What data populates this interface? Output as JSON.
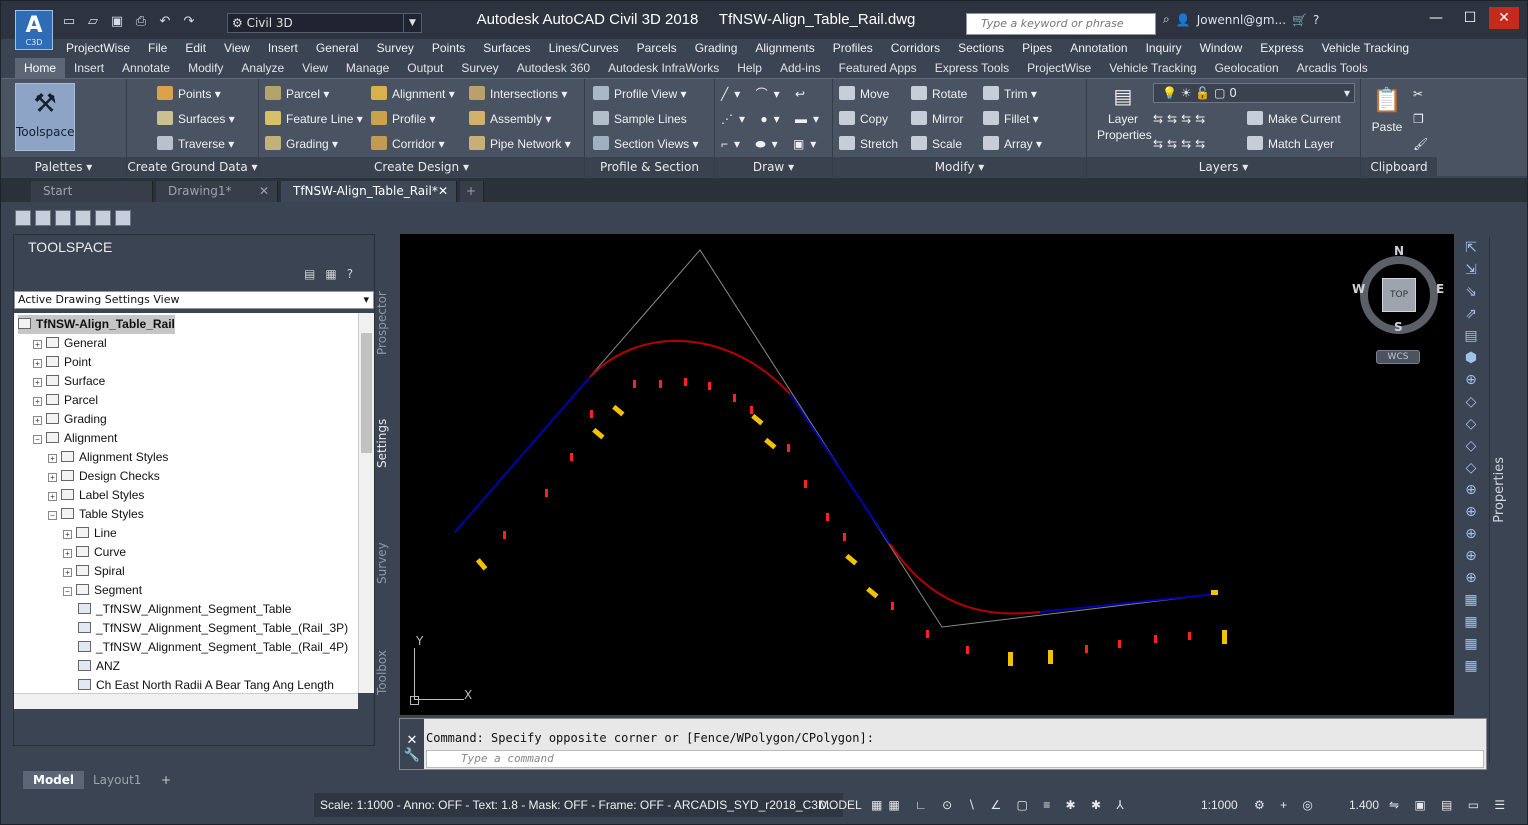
{
  "app": {
    "logo": "A",
    "logo_sub": "C3D",
    "window_title": "Autodesk AutoCAD Civil 3D 2018     TfNSW-Align_Table_Rail.dwg"
  },
  "workspace": {
    "value": "Civil 3D"
  },
  "search": {
    "placeholder": "Type a keyword or phrase"
  },
  "user": {
    "name": "Jowennl@gm..."
  },
  "menubar": [
    "ProjectWise",
    "File",
    "Edit",
    "View",
    "Insert",
    "General",
    "Survey",
    "Points",
    "Surfaces",
    "Lines/Curves",
    "Parcels",
    "Grading",
    "Alignments",
    "Profiles",
    "Corridors",
    "Sections",
    "Pipes",
    "Annotation",
    "Inquiry",
    "Window",
    "Express",
    "Vehicle Tracking"
  ],
  "ribbon_tabs": [
    "Home",
    "Insert",
    "Annotate",
    "Modify",
    "Analyze",
    "View",
    "Manage",
    "Output",
    "Survey",
    "Autodesk 360",
    "Autodesk InfraWorks",
    "Help",
    "Add-ins",
    "Featured Apps",
    "Express Tools",
    "ProjectWise",
    "Vehicle Tracking",
    "Geolocation",
    "Arcadis Tools"
  ],
  "ribbon": {
    "palettes": {
      "title": "Palettes",
      "toolspace": "Toolspace"
    },
    "ground": {
      "title": "Create Ground Data",
      "points": "Points",
      "surfaces": "Surfaces",
      "traverse": "Traverse"
    },
    "design": {
      "title": "Create Design",
      "parcel": "Parcel",
      "feature_line": "Feature Line",
      "grading": "Grading",
      "alignment": "Alignment",
      "profile": "Profile",
      "corridor": "Corridor",
      "intersections": "Intersections",
      "assembly": "Assembly",
      "pipe_network": "Pipe Network"
    },
    "views": {
      "title": "Profile & Section Views",
      "profile_view": "Profile View",
      "sample_lines": "Sample Lines",
      "section_views": "Section Views"
    },
    "draw": {
      "title": "Draw"
    },
    "modify": {
      "title": "Modify",
      "move": "Move",
      "copy": "Copy",
      "stretch": "Stretch",
      "rotate": "Rotate",
      "mirror": "Mirror",
      "scale": "Scale",
      "trim": "Trim",
      "fillet": "Fillet",
      "array": "Array"
    },
    "layers": {
      "title": "Layers",
      "layer_props": "Layer Properties",
      "layer_value": "0",
      "make_current": "Make Current",
      "match_layer": "Match Layer"
    },
    "clipboard": {
      "title": "Clipboard",
      "paste": "Paste"
    }
  },
  "doc_tabs": [
    "Start",
    "Drawing1*",
    "TfNSW-Align_Table_Rail*"
  ],
  "toolspace": {
    "title": "TOOLSPACE",
    "view_dropdown": "Active Drawing Settings View",
    "tree": [
      {
        "label": "TfNSW-Align_Table_Rail",
        "indent": 0,
        "sel": true
      },
      {
        "label": "General",
        "indent": 1
      },
      {
        "label": "Point",
        "indent": 1
      },
      {
        "label": "Surface",
        "indent": 1
      },
      {
        "label": "Parcel",
        "indent": 1
      },
      {
        "label": "Grading",
        "indent": 1
      },
      {
        "label": "Alignment",
        "indent": 1
      },
      {
        "label": "Alignment Styles",
        "indent": 2
      },
      {
        "label": "Design Checks",
        "indent": 2
      },
      {
        "label": "Label Styles",
        "indent": 2
      },
      {
        "label": "Table Styles",
        "indent": 2
      },
      {
        "label": "Line",
        "indent": 3
      },
      {
        "label": "Curve",
        "indent": 3
      },
      {
        "label": "Spiral",
        "indent": 3
      },
      {
        "label": "Segment",
        "indent": 3
      },
      {
        "label": "_TfNSW_Alignment_Segment_Table",
        "indent": 4
      },
      {
        "label": "_TfNSW_Alignment_Segment_Table_(Rail_3P)",
        "indent": 4
      },
      {
        "label": "_TfNSW_Alignment_Segment_Table_(Rail_4P)",
        "indent": 4
      },
      {
        "label": "ANZ",
        "indent": 4
      },
      {
        "label": "Ch East North Radii A Bear Tang Ang Length",
        "indent": 4
      }
    ],
    "side_tabs": [
      "Prospector",
      "Settings",
      "Survey",
      "Toolbox"
    ]
  },
  "viewcube": {
    "n": "N",
    "s": "S",
    "e": "E",
    "w": "W",
    "top": "TOP",
    "wcs": "WCS"
  },
  "ucs": {
    "y": "Y",
    "x": "X"
  },
  "properties_label": "Properties",
  "command": {
    "history": "Command: Specify opposite corner or [Fence/WPolygon/CPolygon]:",
    "placeholder": "Type a command"
  },
  "layout_tabs": [
    "Model",
    "Layout1"
  ],
  "status": {
    "text": "Scale: 1:1000 - Anno: OFF - Text: 1.8 - Mask: OFF - Frame: OFF - ARCADIS_SYD_r2018_C3D...",
    "model": "MODEL",
    "scale": "1:1000",
    "lineweight": "1.400"
  },
  "colors": {
    "accent": "#2e6db5",
    "alignment_curve": "#c00000",
    "tangent_line": "#0000b0"
  }
}
